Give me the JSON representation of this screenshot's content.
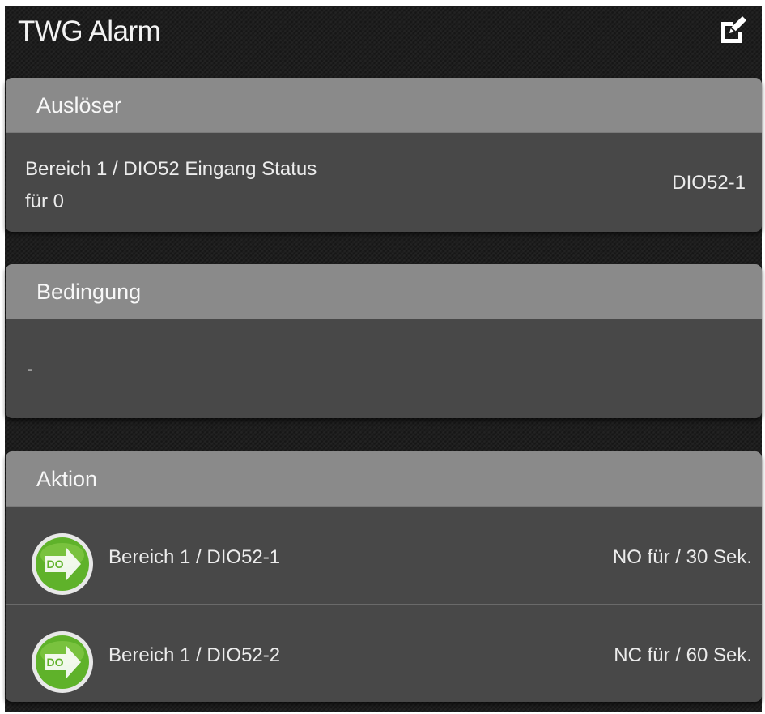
{
  "header": {
    "title": "TWG Alarm",
    "edit_icon": "edit-icon"
  },
  "trigger": {
    "heading": "Auslöser",
    "line1": "Bereich 1 / DIO52 Eingang Status",
    "line2": "für 0",
    "value": "DIO52-1"
  },
  "condition": {
    "heading": "Bedingung",
    "value": "-"
  },
  "action": {
    "heading": "Aktion",
    "items": [
      {
        "icon": "digital-output-icon",
        "badge": "DO",
        "label": "Bereich 1 / DIO52-1",
        "value": "NO für / 30 Sek."
      },
      {
        "icon": "digital-output-icon",
        "badge": "DO",
        "label": "Bereich 1 / DIO52-2",
        "value": "NC für / 60 Sek."
      }
    ]
  },
  "colors": {
    "card_header": "#8a8a8a",
    "card_body": "#484848",
    "badge_green": "#5fb22a"
  }
}
